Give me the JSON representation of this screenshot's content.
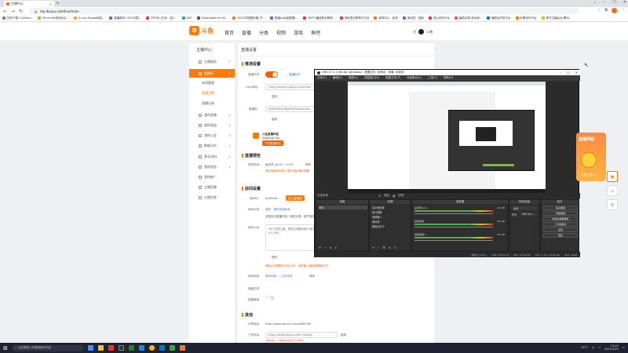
{
  "browser": {
    "tab_title": "主播中心",
    "url": "mp.douyu.com/live/main",
    "bookmarks": [
      {
        "label": "如何下载 L Safosa...",
        "color": "#4a90d9"
      },
      {
        "label": "Minecraft游戏社区...",
        "color": "#8bc34a"
      },
      {
        "label": "Sunny Rigolo网站...",
        "color": "#f5a623"
      },
      {
        "label": "直播服务-1003中国...",
        "color": "#3b7fd9"
      },
      {
        "label": "CPR中心艺术 - 盒C...",
        "color": "#e53935"
      },
      {
        "label": "DXC",
        "color": "#26a69a"
      },
      {
        "label": "Downloads for Mi...",
        "color": "#555555"
      },
      {
        "label": "RUST中国服务器_开...",
        "color": "#ff7043"
      },
      {
        "label": "直播jsa功能配置-...",
        "color": "#3b7fd9"
      },
      {
        "label": "MSTO播放配合教程...",
        "color": "#e53935"
      },
      {
        "label": "海安语文教育开平台",
        "color": "#e53935"
      },
      {
        "label": "影响中心 - 影资",
        "color": "#ff7a00"
      },
      {
        "label": "面试答 - 搜索",
        "color": "#3b7fd9"
      },
      {
        "label": "西瓜创作平台",
        "color": "#e53935"
      },
      {
        "label": "番茄动漫-新动漫...",
        "color": "#ff5252"
      },
      {
        "label": "播放后开发平台",
        "color": "#1976d2"
      },
      {
        "label": "好看创作平台",
        "color": "#ff7a00"
      },
      {
        "label": "虎牙主播后台-腾讯...",
        "color": "#ffb300"
      }
    ]
  },
  "site": {
    "logo_text": "斗鱼",
    "logo_mark": "D",
    "nav": [
      "首页",
      "直播",
      "分类",
      "视频",
      "游戏",
      "鱼吧"
    ],
    "username": "斗鱼"
  },
  "sidebar": {
    "title": "主播中心",
    "items": [
      {
        "label": "主播服务",
        "active": false,
        "chevron": true
      },
      {
        "label": "直播间",
        "active": true,
        "chevron": true
      },
      {
        "label": "我的直播",
        "active": false,
        "chevron": true
      },
      {
        "label": "我的收益",
        "active": false,
        "chevron": true
      },
      {
        "label": "我的公会",
        "active": false,
        "chevron": true
      },
      {
        "label": "数据分析",
        "active": false,
        "chevron": true
      },
      {
        "label": "营业资料",
        "active": false,
        "chevron": true
      },
      {
        "label": "我的权益",
        "active": false,
        "chevron": true
      },
      {
        "label": "我的推广",
        "active": false,
        "chevron": false
      },
      {
        "label": "主播招募",
        "active": false,
        "chevron": false
      },
      {
        "label": "主播学堂",
        "active": false,
        "chevron": false
      }
    ],
    "subitems": [
      {
        "label": "房间管理",
        "on": false
      },
      {
        "label": "直播设置",
        "on": true
      },
      {
        "label": "直播记录",
        "on": false
      }
    ]
  },
  "main": {
    "title": "直播设置",
    "sec_push": "推流设置",
    "live_switch_label": "直播开关:",
    "live_switch_on": true,
    "live_switch_link": "直播推流",
    "rtmp_label": "rtmp地址:",
    "rtmp_value": "rtmp://sendfc3.douyu.com/live",
    "copy1": "复制",
    "code_label": "直播码:",
    "code_value": "6465096rrVBsqD5fTwe5ennet...",
    "copy2": "复制",
    "promo_title": "斗鱼直播伴侣",
    "promo_sub": "直播更简单 高效",
    "promo_btn": "下载直播伴侣",
    "sec_preview": "直播预告",
    "preview_label": "预告时间:",
    "preview_value": "每天早上8:00 - 12:00",
    "preview_edit": "修改",
    "preview_note": "请正确填写时间，便于观众准时观看",
    "sec_room": "房间设置",
    "room_id_label": "房间ID:",
    "room_id_value": "6465096",
    "room_btn": "进入直播间",
    "room_cat_label": "房间分类:",
    "room_cat_value": "单机 · 单机游戏新游",
    "room_cat_edit": "修改",
    "room_cat_note": "请选择与直播内容一致的分类，便于观众发现",
    "notice_label": "房间公告:",
    "notice_text": "MST无限主播，美丽主播期待和大家相遇 QQ群:... 827484",
    "notice_edit": "修改",
    "notice_note": "房间公告限制100字以内，请勿输入链接或联系方式",
    "cover_label": "房间封面:",
    "cover_value": "房间封面-----点击修改",
    "cover_edit": "修改",
    "barrage_label": "弹幕过滤:",
    "hide_label": "直播隐身:",
    "hide_on": false,
    "sec_other": "其他",
    "share_label": "分享地址:",
    "share_value": "https://www.douyu.com/6465096",
    "custom_label": "个性地址:",
    "custom_value": "https://www.douyu.com/ /wdsuy",
    "custom_btn": "使用",
    "custom_note": "请勿设置，个性地址设置后不可修改"
  },
  "obs": {
    "title": "OBS 27.2.4 (64-bit, windows) - 配置文件: 未命名 - 场景: 未命名",
    "menu": [
      "文件(F)",
      "编辑(E)",
      "视图(V)",
      "停靠窗口(D)",
      "配置文件(P)",
      "场景集合(S)",
      "工具(T)",
      "帮助(H)"
    ],
    "status_line": "未选择源",
    "props_btn": "属性",
    "filters_btn": "滤镜",
    "scenes_title": "场景",
    "scenes": [
      "场景"
    ],
    "sources_title": "来源",
    "sources": [
      "显示器采集",
      "窗口捕获",
      "音频输入",
      "媒体源",
      "图像幻灯片"
    ],
    "mixer_title": "混音器",
    "mixer": [
      {
        "name": "麦克风/Aux",
        "db": "0.0 dB"
      },
      {
        "name": "桌面音频",
        "db": "0.0 dB"
      },
      {
        "name": "桌面音频 2",
        "db": "0.0 dB"
      }
    ],
    "transitions_title": "转场动画",
    "transition_value": "淡出",
    "duration_label": "时长",
    "duration_value": "300 ms",
    "controls_title": "控件",
    "controls": [
      "停止推流",
      "开始录制",
      "启动虚拟摄像机",
      "工作室模式",
      "设置",
      "退出"
    ],
    "statusbar": [
      "丢帧 0 (0.0%)",
      "LIVE: 00:00:14",
      "REC: 00:00:00",
      "CPU: 1.3%, 60.00 fps",
      "kb/s: 2536"
    ]
  },
  "promo_float": {
    "title": "直播伴侣",
    "btn": "点击下载 >"
  },
  "taskbar": {
    "search_placeholder": "在这里输入你要搜索的内容",
    "weather": "14°C",
    "clock_time": "14:14",
    "clock_date": "2022/4/29"
  }
}
